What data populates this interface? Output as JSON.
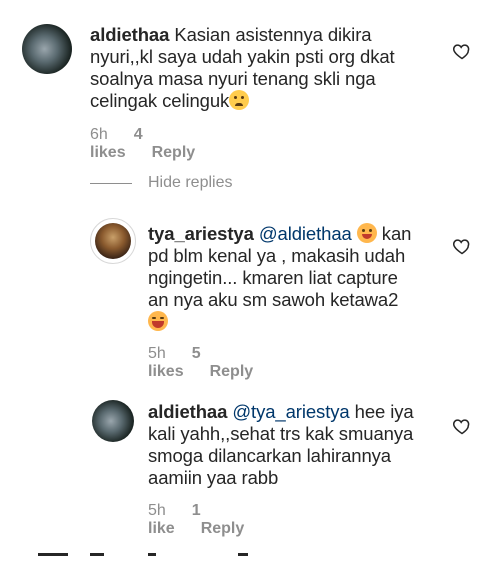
{
  "comments": [
    {
      "username": "aldiethaa",
      "text_lines": [
        "Kasian asistennya dikira",
        "nyuri,,kl saya udah yakin psti org dkat",
        "soalnya masa nyuri tenang skli nga",
        "celingak celinguk"
      ],
      "emoji": "crying-face",
      "time": "6h",
      "likes": "4 likes",
      "reply": "Reply"
    },
    {
      "username": "tya_ariestya",
      "mention": "@aldiethaa",
      "text_lines": [
        "kan",
        "pd blm kenal ya , makasih udah",
        "ngingetin... kmaren liat capture",
        "an nya aku sm sawoh ketawa2"
      ],
      "emoji_inline": "smiling-face",
      "emoji_end": "laughing-face",
      "time": "5h",
      "likes": "5 likes",
      "reply": "Reply"
    },
    {
      "username": "aldiethaa",
      "mention": "@tya_ariestya",
      "text_lines": [
        "hee iya",
        "kali yahh,,sehat trs kak smuanya",
        "smoga dilancarkan lahirannya",
        "aamiin yaa rabb"
      ],
      "time": "5h",
      "likes": "1 like",
      "reply": "Reply"
    }
  ],
  "hide_replies": "Hide replies",
  "colors": {
    "text": "#262626",
    "meta": "#8e8e8e",
    "mention": "#00376b"
  }
}
